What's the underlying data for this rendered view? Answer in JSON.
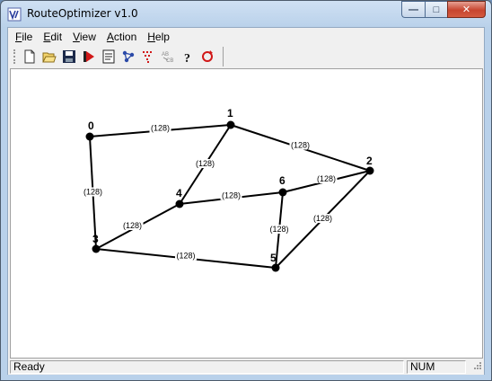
{
  "window": {
    "title": "RouteOptimizer v1.0",
    "caption_buttons": {
      "minimize": "—",
      "maximize": "□",
      "close": "✕"
    }
  },
  "menu": [
    {
      "underlined": "F",
      "rest": "ile"
    },
    {
      "underlined": "E",
      "rest": "dit"
    },
    {
      "underlined": "V",
      "rest": "iew"
    },
    {
      "underlined": "A",
      "rest": "ction"
    },
    {
      "underlined": "H",
      "rest": "elp"
    }
  ],
  "toolbar": {
    "buttons": [
      {
        "name": "new-icon"
      },
      {
        "name": "open-icon"
      },
      {
        "name": "save-icon"
      },
      {
        "name": "run-icon"
      },
      {
        "name": "properties-icon"
      },
      {
        "name": "graph-icon"
      },
      {
        "name": "sort-icon"
      },
      {
        "name": "route-icon"
      },
      {
        "name": "help-icon"
      },
      {
        "name": "refresh-icon"
      }
    ]
  },
  "graph": {
    "nodes": [
      {
        "id": "0",
        "label": "0"
      },
      {
        "id": "1",
        "label": "1"
      },
      {
        "id": "2",
        "label": "2"
      },
      {
        "id": "3",
        "label": "3"
      },
      {
        "id": "4",
        "label": "4"
      },
      {
        "id": "5",
        "label": "5"
      },
      {
        "id": "6",
        "label": "6"
      }
    ],
    "edges": [
      {
        "from": "0",
        "to": "1",
        "weight": "(128)"
      },
      {
        "from": "1",
        "to": "2",
        "weight": "(128)"
      },
      {
        "from": "0",
        "to": "3",
        "weight": "(128)"
      },
      {
        "from": "1",
        "to": "4",
        "weight": "(128)"
      },
      {
        "from": "4",
        "to": "6",
        "weight": "(128)"
      },
      {
        "from": "6",
        "to": "2",
        "weight": "(128)"
      },
      {
        "from": "3",
        "to": "4",
        "weight": "(128)"
      },
      {
        "from": "6",
        "to": "5",
        "weight": "(128)"
      },
      {
        "from": "2",
        "to": "5",
        "weight": "(128)"
      },
      {
        "from": "3",
        "to": "5",
        "weight": "(128)"
      }
    ]
  },
  "status": {
    "message": "Ready",
    "num": "NUM"
  }
}
